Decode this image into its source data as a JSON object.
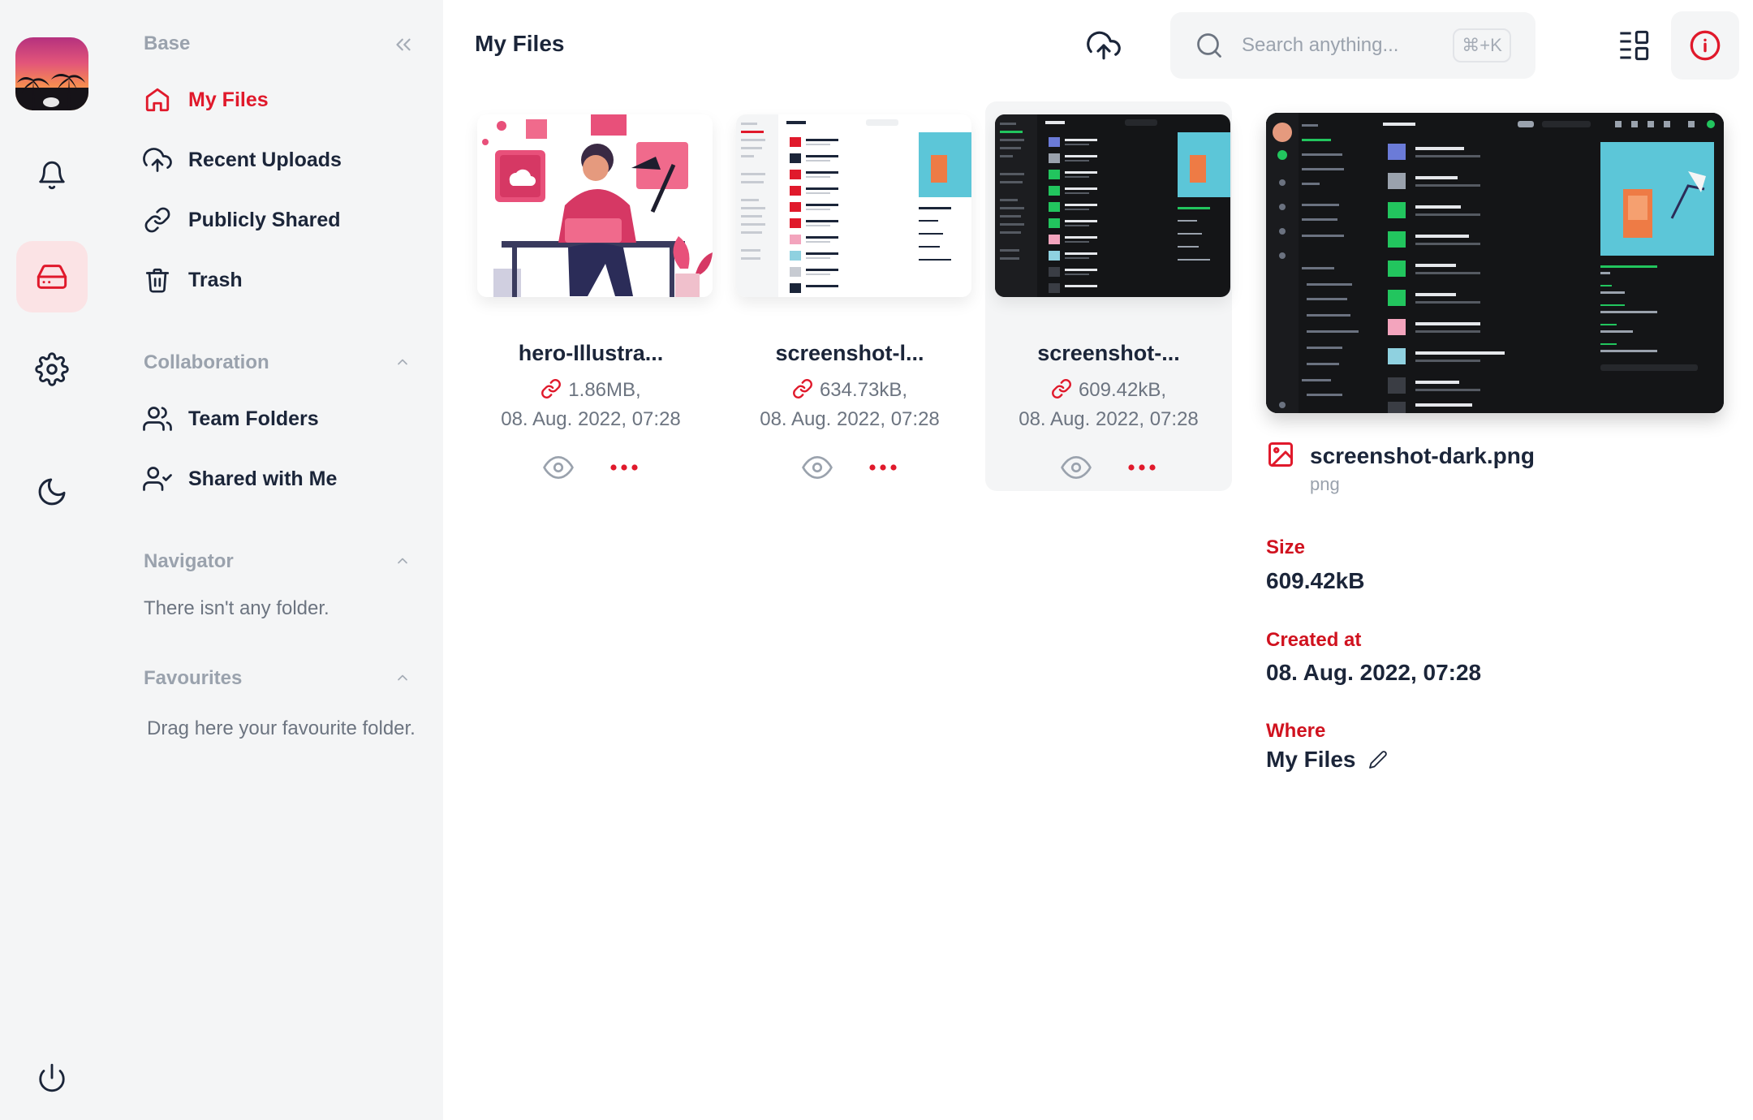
{
  "app": {
    "page_title": "My Files"
  },
  "sidebar": {
    "base_title": "Base",
    "items": [
      {
        "label": "My Files",
        "icon": "home-icon"
      },
      {
        "label": "Recent Uploads",
        "icon": "cloud-upload-icon"
      },
      {
        "label": "Publicly Shared",
        "icon": "link-icon"
      },
      {
        "label": "Trash",
        "icon": "trash-icon"
      }
    ],
    "collaboration_title": "Collaboration",
    "collaboration_items": [
      {
        "label": "Team Folders",
        "icon": "users-icon"
      },
      {
        "label": "Shared with Me",
        "icon": "user-check-icon"
      }
    ],
    "navigator_title": "Navigator",
    "navigator_empty": "There isn't any folder.",
    "favourites_title": "Favourites",
    "favourites_empty": "Drag here your favourite folder."
  },
  "search": {
    "placeholder": "Search anything...",
    "shortcut": "⌘+K"
  },
  "files": [
    {
      "name": "hero-Illustra...",
      "size": "1.86MB,",
      "date": "08. Aug. 2022, 07:28"
    },
    {
      "name": "screenshot-l...",
      "size": "634.73kB,",
      "date": "08. Aug. 2022, 07:28"
    },
    {
      "name": "screenshot-...",
      "size": "609.42kB,",
      "date": "08. Aug. 2022, 07:28"
    }
  ],
  "detail": {
    "name": "screenshot-dark.png",
    "ext": "png",
    "size_label": "Size",
    "size_value": "609.42kB",
    "created_label": "Created at",
    "created_value": "08. Aug. 2022, 07:28",
    "where_label": "Where",
    "where_value": "My Files"
  },
  "colors": {
    "accent": "#e0192b",
    "text": "#1b2539",
    "muted": "#9aa2ad",
    "panel": "#f4f5f6"
  }
}
